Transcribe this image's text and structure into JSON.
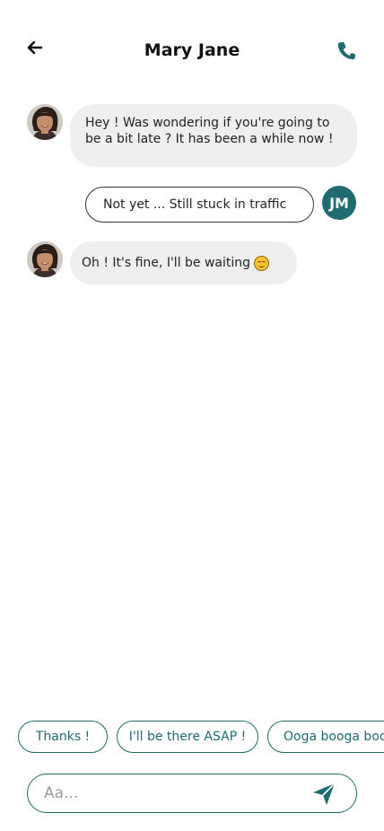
{
  "header": {
    "title": "Mary Jane",
    "back_icon": "arrow-left-icon",
    "call_icon": "phone-icon"
  },
  "colors": {
    "accent": "#1f6b70",
    "incoming_bubble": "#efefef",
    "outgoing_border": "#333333"
  },
  "messages": [
    {
      "from": "contact",
      "text": "Hey ! Was wondering if you're going to be a bit late ? It has been a while now !"
    },
    {
      "from": "me",
      "text": "Not yet ... Still stuck in traffic",
      "avatar_initials": "JM"
    },
    {
      "from": "contact",
      "text": "Oh ! It's fine, I'll be waiting",
      "emoji": "smiling-face-emoji"
    }
  ],
  "quick_replies": [
    "Thanks !",
    "I'll be there ASAP !",
    "Ooga booga boo"
  ],
  "composer": {
    "placeholder": "Aa...",
    "value": "",
    "send_icon": "send-icon"
  }
}
